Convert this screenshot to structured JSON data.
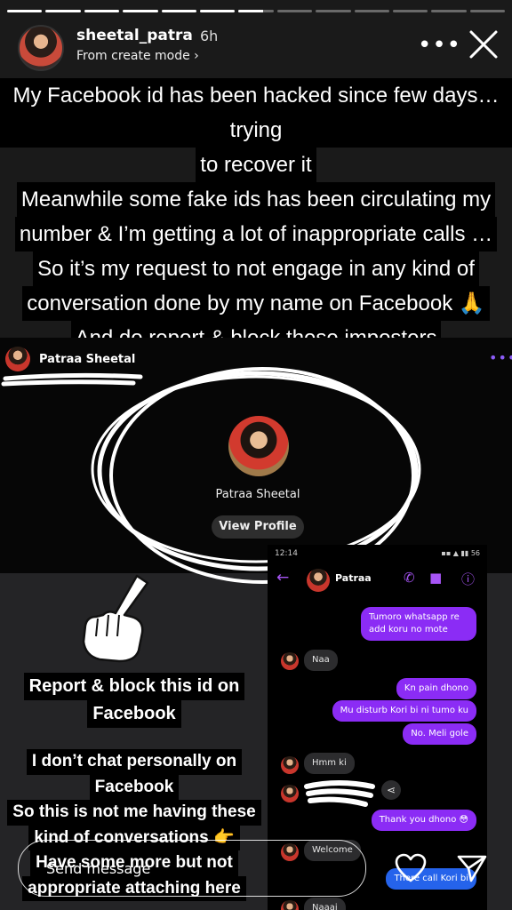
{
  "story": {
    "segments_total": 13,
    "segments_done": 6,
    "current_progress": 0.7,
    "username": "sheetal_patra",
    "time_ago": "6h",
    "subline": "From create mode ›",
    "caption_lines": [
      "My Facebook id has been hacked since few days…trying",
      "to recover it",
      "Meanwhile some fake ids has been circulating my",
      "number & I’m getting a lot of inappropriate calls …",
      "So it’s my request to not engage in any kind of",
      "conversation done by my name on Facebook 🙏",
      "And do report & block these imposters"
    ]
  },
  "fb_profile": {
    "header_name": "Patraa Sheetal",
    "profile_name": "Patraa Sheetal",
    "view_profile": "View Profile"
  },
  "labels": {
    "report_lines": [
      "Report & block this id on",
      "Facebook"
    ],
    "note_lines": [
      "I don’t chat personally on",
      "Facebook",
      "So this is not me having these",
      "kind of conversations 👉",
      "Have some more but not",
      "appropriate attaching here"
    ]
  },
  "chat": {
    "time": "12:14",
    "status_right": "▪▪ ▲ ▮▮ 56",
    "contact": "Patraa",
    "messages": [
      {
        "text": "Tumoro whatsapp re add koru no mote",
        "dir": "out"
      },
      {
        "text": "Naa",
        "dir": "in"
      },
      {
        "text": "Kn pain dhono",
        "dir": "out"
      },
      {
        "text": "Mu disturb Kori bi ni tumo ku",
        "dir": "out"
      },
      {
        "text": "No. Meli gole",
        "dir": "out"
      },
      {
        "text": "Hmm ki",
        "dir": "in"
      },
      {
        "text": "Thank you dhono 😳",
        "dir": "out"
      },
      {
        "text": "Welcome",
        "dir": "in"
      },
      {
        "text": "There call Kori bi",
        "dir": "out"
      },
      {
        "text": "Naaai",
        "dir": "in"
      }
    ]
  },
  "bottom": {
    "send_placeholder": "Send message"
  }
}
